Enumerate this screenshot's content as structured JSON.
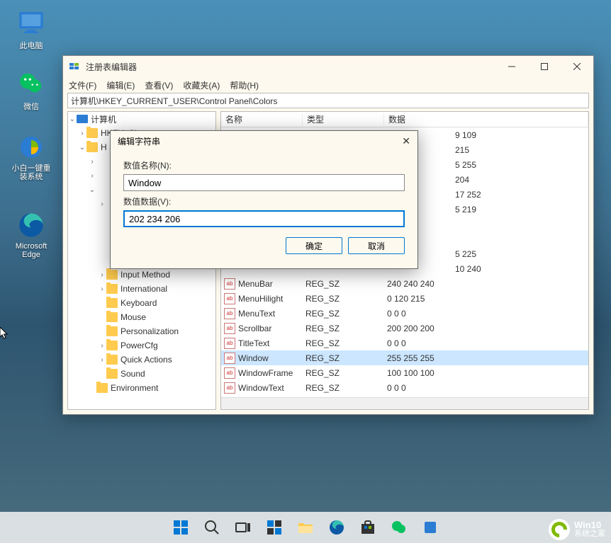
{
  "desktop": {
    "icons": [
      {
        "name": "pc",
        "label": "此电脑"
      },
      {
        "name": "wechat",
        "label": "微信"
      },
      {
        "name": "xiaobai",
        "label": "小白一键重装系统"
      },
      {
        "name": "edge",
        "label": "Microsoft Edge"
      }
    ]
  },
  "window": {
    "title": "注册表编辑器",
    "menu": [
      "文件(F)",
      "编辑(E)",
      "查看(V)",
      "收藏夹(A)",
      "帮助(H)"
    ],
    "address": "计算机\\HKEY_CURRENT_USER\\Control Panel\\Colors"
  },
  "tree": {
    "root": "计算机",
    "items": [
      {
        "label": "Input Method",
        "indent": 3,
        "tw": "›"
      },
      {
        "label": "International",
        "indent": 3,
        "tw": "›"
      },
      {
        "label": "Keyboard",
        "indent": 3,
        "tw": ""
      },
      {
        "label": "Mouse",
        "indent": 3,
        "tw": ""
      },
      {
        "label": "Personalization",
        "indent": 3,
        "tw": ""
      },
      {
        "label": "PowerCfg",
        "indent": 3,
        "tw": "›"
      },
      {
        "label": "Quick Actions",
        "indent": 3,
        "tw": "›"
      },
      {
        "label": "Sound",
        "indent": 3,
        "tw": ""
      },
      {
        "label": "Environment",
        "indent": 2,
        "tw": ""
      }
    ]
  },
  "list": {
    "headers": {
      "name": "名称",
      "type": "类型",
      "data": "数据"
    },
    "partial_rows": [
      {
        "data": "9 109"
      },
      {
        "data": "215"
      },
      {
        "data": "5 255"
      },
      {
        "data": "204"
      },
      {
        "data": "17 252"
      },
      {
        "data": "5 219"
      }
    ],
    "gap_rows": [
      {
        "data": "5 225"
      },
      {
        "data": "10 240"
      }
    ],
    "rows": [
      {
        "name": "MenuBar",
        "type": "REG_SZ",
        "data": "240 240 240"
      },
      {
        "name": "MenuHilight",
        "type": "REG_SZ",
        "data": "0 120 215"
      },
      {
        "name": "MenuText",
        "type": "REG_SZ",
        "data": "0 0 0"
      },
      {
        "name": "Scrollbar",
        "type": "REG_SZ",
        "data": "200 200 200"
      },
      {
        "name": "TitleText",
        "type": "REG_SZ",
        "data": "0 0 0"
      },
      {
        "name": "Window",
        "type": "REG_SZ",
        "data": "255 255 255"
      },
      {
        "name": "WindowFrame",
        "type": "REG_SZ",
        "data": "100 100 100"
      },
      {
        "name": "WindowText",
        "type": "REG_SZ",
        "data": "0 0 0"
      }
    ]
  },
  "dialog": {
    "title": "编辑字符串",
    "name_label": "数值名称(N):",
    "name_value": "Window",
    "data_label": "数值数据(V):",
    "data_value": "202 234 206",
    "ok": "确定",
    "cancel": "取消"
  },
  "watermark": {
    "line1": "Win10",
    "line2": "系统之家"
  }
}
